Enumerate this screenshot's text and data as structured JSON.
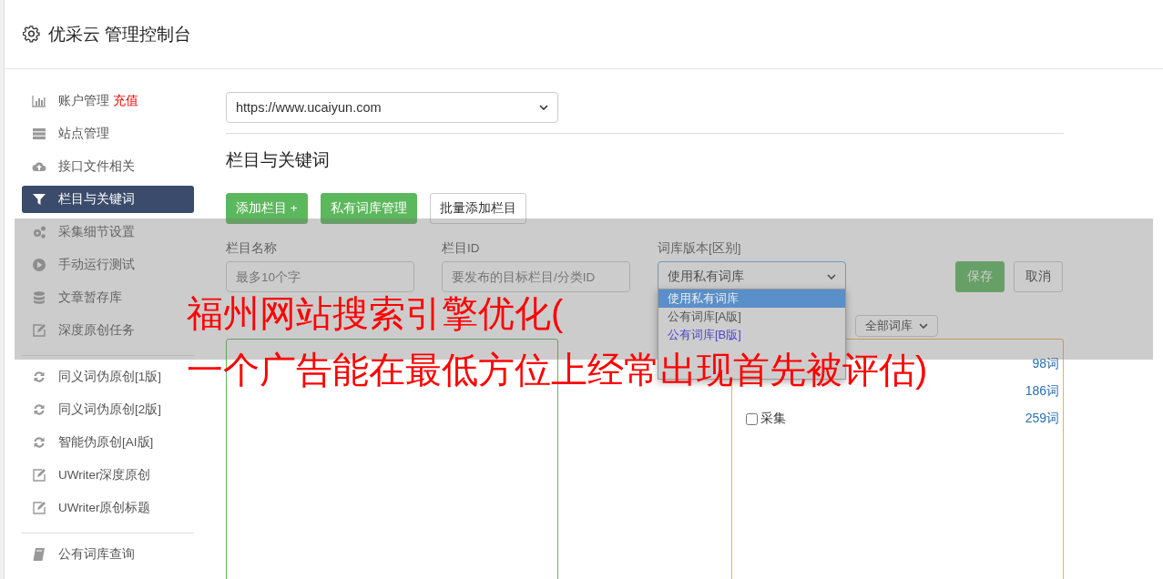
{
  "header": {
    "title": "优采云 管理控制台"
  },
  "sidebar": {
    "groups": [
      {
        "items": [
          {
            "label": "账户管理",
            "badge": "充值",
            "selected": false
          },
          {
            "label": "站点管理",
            "selected": false
          },
          {
            "label": "接口文件相关",
            "selected": false
          },
          {
            "label": "栏目与关键词",
            "selected": true
          },
          {
            "label": "采集细节设置",
            "selected": false
          },
          {
            "label": "手动运行测试",
            "selected": false
          },
          {
            "label": "文章暂存库",
            "selected": false
          },
          {
            "label": "深度原创任务",
            "selected": false
          }
        ]
      },
      {
        "items": [
          {
            "label": "同义词伪原创[1版]",
            "selected": false
          },
          {
            "label": "同义词伪原创[2版]",
            "selected": false
          },
          {
            "label": "智能伪原创[AI版]",
            "selected": false
          },
          {
            "label": "UWriter深度原创",
            "selected": false
          },
          {
            "label": "UWriter原创标题",
            "selected": false
          }
        ]
      },
      {
        "items": [
          {
            "label": "公有词库查询",
            "selected": false
          }
        ]
      }
    ]
  },
  "site_select": {
    "value": "https://www.ucaiyun.com"
  },
  "section_title": "栏目与关键词",
  "buttons": [
    {
      "label": "添加栏目 +",
      "kind": "primary"
    },
    {
      "label": "私有词库管理",
      "kind": "primary"
    },
    {
      "label": "批量添加栏目",
      "kind": "default"
    }
  ],
  "form": {
    "fields": [
      {
        "label": "栏目名称",
        "placeholder": "最多10个字",
        "kind": "input"
      },
      {
        "label": "栏目ID",
        "placeholder": "要发布的目标栏目/分类ID",
        "kind": "input"
      },
      {
        "label": "词库版本[区别]",
        "value": "使用私有词库",
        "kind": "select"
      }
    ],
    "save": "保存",
    "cancel": "取消",
    "dropdown": [
      {
        "label": "使用私有词库",
        "selected": true
      },
      {
        "label": "公有词库[A版]",
        "selected": false,
        "color": "#555555"
      },
      {
        "label": "公有词库[B版]",
        "selected": false,
        "color": "#4f44cc"
      }
    ]
  },
  "library_filter": {
    "value": "全部词库"
  },
  "libraries": [
    {
      "count": "98词"
    },
    {
      "count": "186词"
    },
    {
      "label": "采集",
      "count": "259词",
      "checked": false
    }
  ],
  "overlay_caption": [
    "福州网站搜索引擎优化(",
    "一个广告能在最低方位上经常出现首先被评估)"
  ]
}
